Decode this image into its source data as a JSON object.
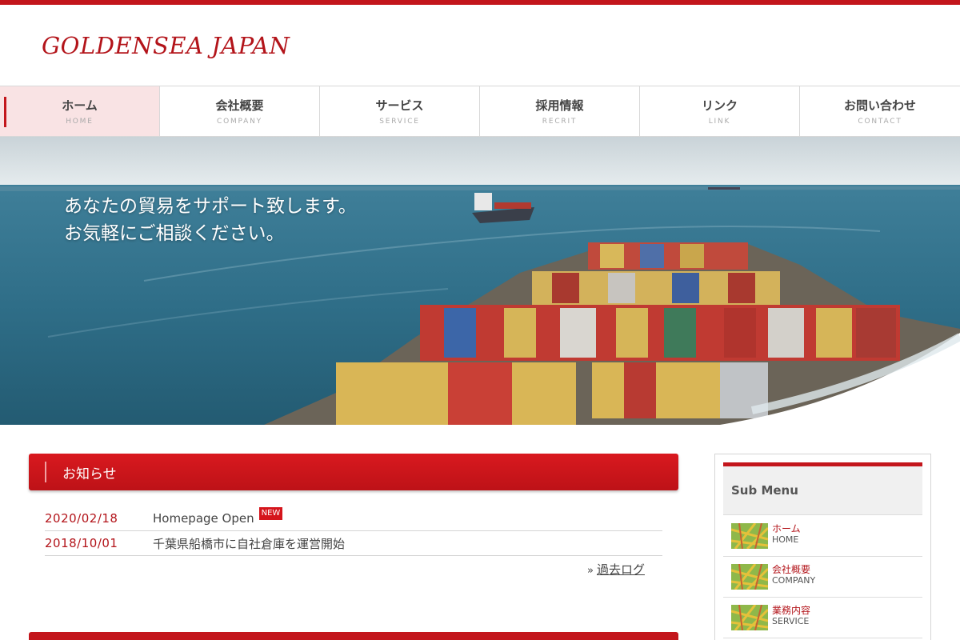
{
  "brand": {
    "logo": "GOLDENSEA JAPAN",
    "accent": "#c3161c"
  },
  "nav": {
    "items": [
      {
        "jp": "ホーム",
        "en": "HOME",
        "active": true
      },
      {
        "jp": "会社概要",
        "en": "COMPANY"
      },
      {
        "jp": "サービス",
        "en": "SERVICE"
      },
      {
        "jp": "採用情報",
        "en": "RECRIT"
      },
      {
        "jp": "リンク",
        "en": "LINK"
      },
      {
        "jp": "お問い合わせ",
        "en": "CONTACT"
      }
    ]
  },
  "hero": {
    "line1": "あなたの貿易をサポート致します。",
    "line2": "お気軽にご相談ください。",
    "image": "container-ship-photo"
  },
  "news": {
    "title": "お知らせ",
    "items": [
      {
        "date": "2020/02/18",
        "text": "Homepage Open",
        "badge": "NEW"
      },
      {
        "date": "2018/10/01",
        "text": "千葉県船橋市に自社倉庫を運営開始"
      }
    ],
    "archive_arrow": "»",
    "archive_label": "過去ログ"
  },
  "sidebar": {
    "title": "Sub Menu",
    "items": [
      {
        "jp": "ホーム",
        "en": "HOME"
      },
      {
        "jp": "会社概要",
        "en": "COMPANY"
      },
      {
        "jp": "業務内容",
        "en": "SERVICE"
      }
    ]
  }
}
